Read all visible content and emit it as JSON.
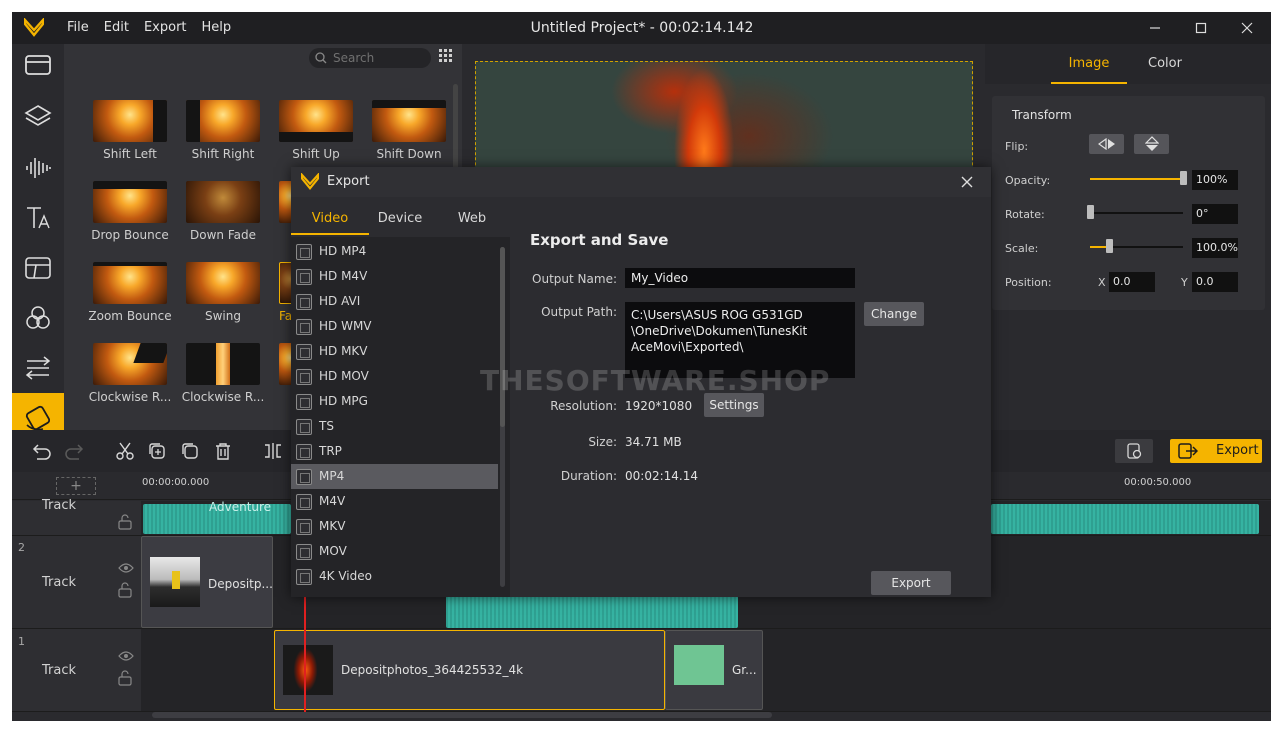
{
  "window": {
    "title": "Untitled Project* - 00:02:14.142",
    "menu": [
      "File",
      "Edit",
      "Export",
      "Help"
    ],
    "accent": "#f5b400"
  },
  "library": {
    "search_placeholder": "Search",
    "items": [
      "Shift Left",
      "Shift Right",
      "Shift Up",
      "Shift Down",
      "Drop Bounce",
      "Down Fade",
      "Zoom Bounce",
      "Swing",
      "Fa",
      "Clockwise R...",
      "Clockwise R..."
    ]
  },
  "properties": {
    "tabs": [
      "Image",
      "Color"
    ],
    "section": "Transform",
    "labels": {
      "flip": "Flip:",
      "opacity": "Opacity:",
      "rotate": "Rotate:",
      "scale": "Scale:",
      "position": "Position:",
      "x": "X",
      "y": "Y"
    },
    "opacity": "100%",
    "opacity_level": 1.0,
    "rotate": "0°",
    "rotate_level": 0.0,
    "scale": "100.0%",
    "scale_level": 0.2,
    "pos_x": "0.0",
    "pos_y": "0.0"
  },
  "toolbar": {
    "export_label": "Export"
  },
  "timeline": {
    "ruler": {
      "start": "00:00:00.000",
      "mark": "00:00:50.000"
    },
    "tracks": [
      {
        "number": "2",
        "name": "Track"
      },
      {
        "number": "1",
        "name": "Track"
      }
    ],
    "top_track_name": "Track",
    "clips": {
      "audio": "Adventure",
      "video2": "Depositp...",
      "video1": "Depositphotos_364425532_4k",
      "green": "Gr..."
    }
  },
  "export_dialog": {
    "title": "Export",
    "tabs": [
      "Video",
      "Device",
      "Web"
    ],
    "formats": [
      "HD MP4",
      "HD M4V",
      "HD AVI",
      "HD WMV",
      "HD MKV",
      "HD MOV",
      "HD MPG",
      "TS",
      "TRP",
      "MP4",
      "M4V",
      "MKV",
      "MOV",
      "4K Video"
    ],
    "selected_format": "MP4",
    "heading": "Export and Save",
    "output_name_label": "Output Name:",
    "output_name": "My_Video",
    "output_path_label": "Output Path:",
    "output_path_lines": [
      "C:\\Users\\ASUS ROG G531GD",
      "\\OneDrive\\Dokumen\\TunesKit",
      "AceMovi\\Exported\\"
    ],
    "change_label": "Change",
    "resolution_label": "Resolution:",
    "resolution": "1920*1080",
    "settings_label": "Settings",
    "size_label": "Size:",
    "size": "34.71 MB",
    "duration_label": "Duration:",
    "duration": "00:02:14.14",
    "export_label": "Export"
  },
  "watermark": "THESOFTWARE.SHOP"
}
